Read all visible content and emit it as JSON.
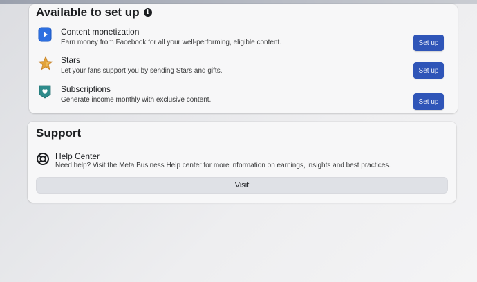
{
  "setup_section": {
    "title": "Available to set up",
    "items": [
      {
        "title": "Content monetization",
        "description": "Earn money from Facebook for all your well-performing, eligible content.",
        "button": "Set up",
        "icon": "play-icon"
      },
      {
        "title": "Stars",
        "description": "Let your fans support you by sending Stars and gifts.",
        "button": "Set up",
        "icon": "star-icon"
      },
      {
        "title": "Subscriptions",
        "description": "Generate income monthly with exclusive content.",
        "button": "Set up",
        "icon": "heart-shield-icon"
      }
    ]
  },
  "support_section": {
    "title": "Support",
    "help_center": {
      "title": "Help Center",
      "description": "Need help? Visit the Meta Business Help center for more information on earnings, insights and best practices.",
      "icon": "lifebuoy-icon"
    },
    "visit_button": "Visit"
  },
  "colors": {
    "primary_button": "#2f55b8",
    "card_background": "#f7f7f8",
    "secondary_button": "#dfe1e6"
  }
}
